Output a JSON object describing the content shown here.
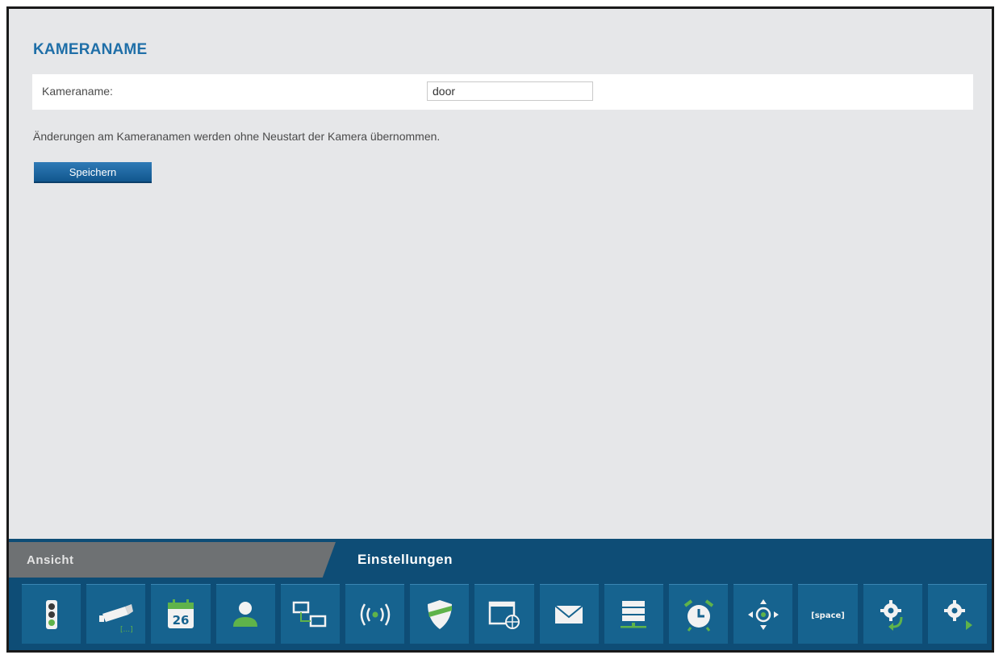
{
  "section": {
    "title": "KAMERANAME",
    "label": "Kameraname:",
    "value": "door",
    "info": "Änderungen am Kameranamen werden ohne Neustart der Kamera übernommen.",
    "save_label": "Speichern"
  },
  "tabs": {
    "ansicht": "Ansicht",
    "einstellungen": "Einstellungen"
  },
  "toolbar": {
    "icons": [
      "status-light-icon",
      "camera-icon",
      "calendar-icon",
      "user-icon",
      "network-icon",
      "wireless-icon",
      "shield-icon",
      "web-icon",
      "mail-icon",
      "server-icon",
      "alarm-clock-icon",
      "pan-tilt-icon",
      "space-icon",
      "settings-restore-icon",
      "settings-next-icon"
    ],
    "calendar_day": "26",
    "camera_caption": "[...]",
    "space_label": "[space]"
  },
  "colors": {
    "accent": "#1f6fa8",
    "toolbar_bg": "#0e4d76",
    "icon_green": "#5fb34a"
  }
}
